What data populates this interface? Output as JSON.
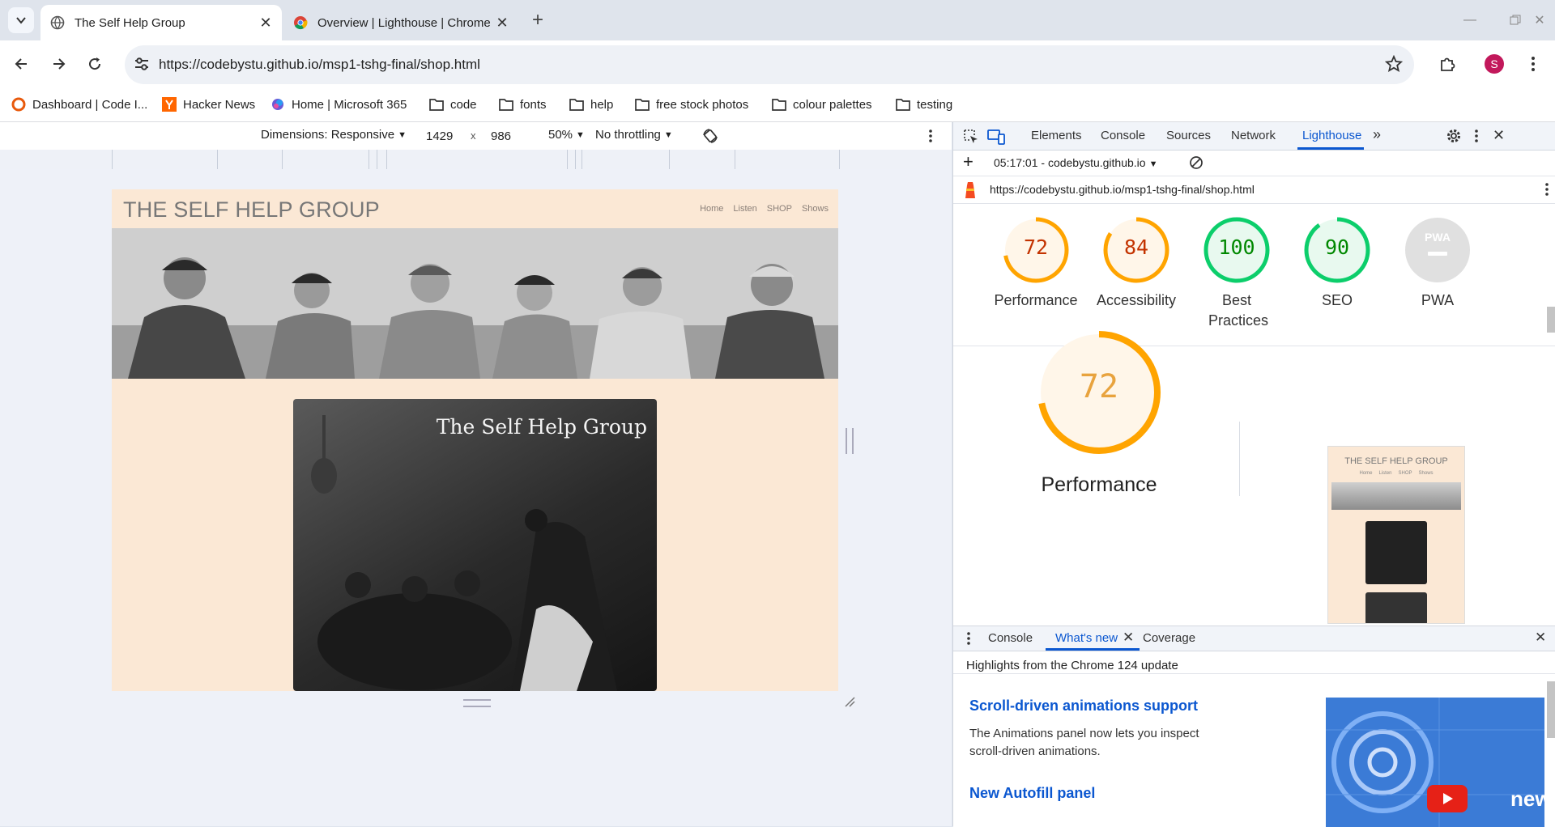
{
  "browser": {
    "tabs": [
      {
        "title": "The Self Help Group",
        "active": true
      },
      {
        "title": "Overview  |  Lighthouse  |  Chrome",
        "active": false
      }
    ],
    "address": "https://codebystu.github.io/msp1-tshg-final/shop.html",
    "profile_initial": "S",
    "bookmarks": [
      {
        "label": "Dashboard | Code I...",
        "icon": "codeinstitute-icon"
      },
      {
        "label": "Hacker News",
        "icon": "hackernews-icon"
      },
      {
        "label": "Home | Microsoft 365",
        "icon": "microsoft365-icon"
      },
      {
        "label": "code",
        "icon": "folder-icon"
      },
      {
        "label": "fonts",
        "icon": "folder-icon"
      },
      {
        "label": "help",
        "icon": "folder-icon"
      },
      {
        "label": "free stock photos",
        "icon": "folder-icon"
      },
      {
        "label": "colour palettes",
        "icon": "folder-icon"
      },
      {
        "label": "testing",
        "icon": "folder-icon"
      }
    ]
  },
  "device_toolbar": {
    "dimensions": "Dimensions: Responsive",
    "width": "1429",
    "times": "x",
    "height": "986",
    "zoom": "50%",
    "throttling": "No throttling"
  },
  "site": {
    "logo": "THE SELF HELP GROUP",
    "nav": [
      "Home",
      "Listen",
      "SHOP",
      "Shows"
    ],
    "album_title": "The Self Help Group"
  },
  "devtools": {
    "tabs": [
      "Elements",
      "Console",
      "Sources",
      "Network",
      "Lighthouse"
    ],
    "active_tab": "Lighthouse",
    "report_select": "05:17:01 - codebystu.github.io",
    "report_url": "https://codebystu.github.io/msp1-tshg-final/shop.html",
    "scores": [
      {
        "label": "Performance",
        "value": "72",
        "score": 72,
        "color": "#ffa400"
      },
      {
        "label": "Accessibility",
        "value": "84",
        "score": 84,
        "color": "#ffa400"
      },
      {
        "label": "Best Practices",
        "value": "100",
        "score": 100,
        "color": "#0cce6b"
      },
      {
        "label": "SEO",
        "value": "90",
        "score": 90,
        "color": "#0cce6b"
      },
      {
        "label": "PWA",
        "value": "PWA",
        "score": 0,
        "color": "#cccccc"
      }
    ],
    "big_score": {
      "label": "Performance",
      "value": "72",
      "score": 72
    },
    "thumbnail": {
      "logo": "THE SELF HELP GROUP",
      "nav": [
        "Home",
        "Listen",
        "SHOP",
        "Shows"
      ]
    },
    "drawer": {
      "tabs": [
        "Console",
        "What's new",
        "Coverage"
      ],
      "active_tab": "What's new",
      "headline": "Highlights from the Chrome 124 update",
      "items": [
        {
          "title": "Scroll-driven animations support",
          "body": "The Animations panel now lets you inspect scroll-driven animations."
        },
        {
          "title": "New Autofill panel",
          "body": ""
        }
      ],
      "video_badge": "new"
    }
  }
}
